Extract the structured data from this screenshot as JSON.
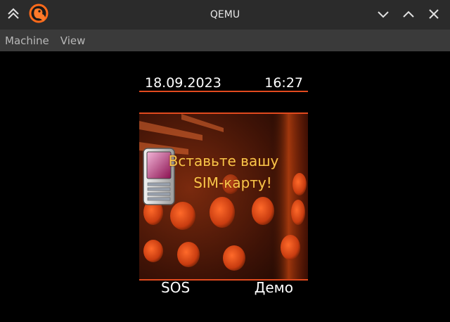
{
  "window": {
    "title": "QEMU",
    "colors": {
      "titlebar": "#2b2b2b",
      "menubar": "#3a3a3a",
      "accent": "#e24a1e"
    }
  },
  "menubar": {
    "items": [
      {
        "label": "Machine"
      },
      {
        "label": "View"
      }
    ]
  },
  "phone": {
    "status": {
      "date": "18.09.2023",
      "time": "16:27"
    },
    "message": {
      "line1": "Вставьте вашу",
      "line2": "SIM-карту!"
    },
    "softkeys": {
      "left": "SOS",
      "right": "Демо"
    },
    "colors": {
      "message": "#f7c64a",
      "separator": "#e24a1e"
    }
  }
}
